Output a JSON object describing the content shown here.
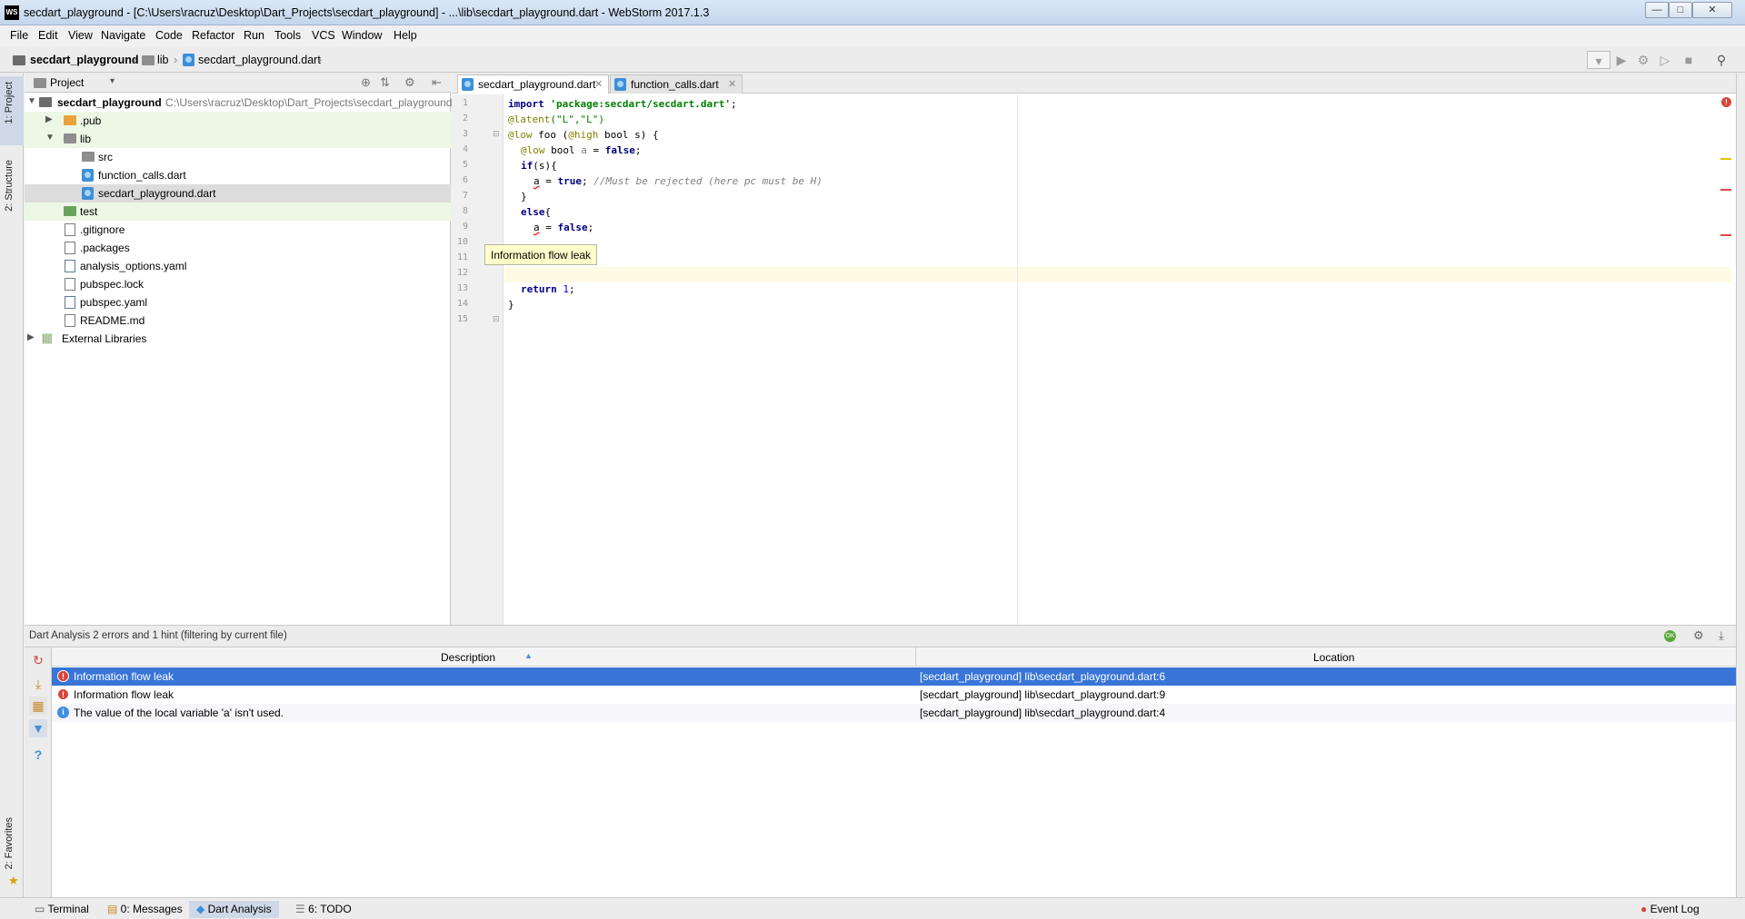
{
  "window": {
    "title": "secdart_playground - [C:\\Users\\racruz\\Desktop\\Dart_Projects\\secdart_playground] - ...\\lib\\secdart_playground.dart - WebStorm 2017.1.3",
    "logo": "WS"
  },
  "menu": [
    "File",
    "Edit",
    "View",
    "Navigate",
    "Code",
    "Refactor",
    "Run",
    "Tools",
    "VCS",
    "Window",
    "Help"
  ],
  "breadcrumb": [
    "secdart_playground",
    "lib",
    "secdart_playground.dart"
  ],
  "left_strip": {
    "project_tab": "1: Project",
    "structure_tab": "2: Structure",
    "favorites_tab": "2: Favorites"
  },
  "project": {
    "header": "Project",
    "root_name": "secdart_playground",
    "root_path": "C:\\Users\\racruz\\Desktop\\Dart_Projects\\secdart_playground",
    "items": [
      ".pub",
      "lib",
      "src",
      "function_calls.dart",
      "secdart_playground.dart",
      "test",
      ".gitignore",
      ".packages",
      "analysis_options.yaml",
      "pubspec.lock",
      "pubspec.yaml",
      "README.md",
      "External Libraries"
    ]
  },
  "editor": {
    "tabs": [
      "secdart_playground.dart",
      "function_calls.dart"
    ],
    "line_numbers": [
      "1",
      "2",
      "3",
      "4",
      "5",
      "6",
      "7",
      "8",
      "9",
      "10",
      "11",
      "12",
      "13",
      "14",
      "15"
    ],
    "code": {
      "l1_kw": "import ",
      "l1_str": "'package:secdart/secdart.dart'",
      "l1_end": ";",
      "l2_ann": "@latent",
      "l2_args": "(\"L\",\"L\")",
      "l3_ann": "@low",
      "l3_a": " foo (",
      "l3_ann2": "@high",
      "l3_b": " bool s) {",
      "l4_ann": "@low",
      "l4_a": " bool ",
      "l4_var": "a",
      "l4_b": " = ",
      "l4_kw": "false",
      "l4_end": ";",
      "l5_kw": "if",
      "l5_rest": "(s){",
      "l6_var": "a",
      "l6_a": " = ",
      "l6_kw": "true",
      "l6_b": "; ",
      "l6_cmt": "//Must be rejected (here pc must be H)",
      "l7": "}",
      "l8_kw": "else",
      "l8_rest": "{",
      "l9_var": "a",
      "l9_a": " = ",
      "l9_kw": "false",
      "l9_end": ";",
      "l13_kw": "return ",
      "l13_num": "1",
      "l13_end": ";",
      "l14": "}"
    },
    "tooltip": "Information flow leak"
  },
  "bottom": {
    "header": "Dart Analysis 2 errors and 1 hint (filtering by current file)",
    "col_description": "Description",
    "col_location": "Location",
    "problems": [
      {
        "description": "Information flow leak",
        "location": "[secdart_playground] lib\\secdart_playground.dart:6",
        "severity": "error"
      },
      {
        "description": "Information flow leak",
        "location": "[secdart_playground] lib\\secdart_playground.dart:9",
        "severity": "error"
      },
      {
        "description": "The value of the local variable 'a' isn't used.",
        "location": "[secdart_playground] lib\\secdart_playground.dart:4",
        "severity": "hint"
      }
    ]
  },
  "statusbar": {
    "terminal": "Terminal",
    "messages": "0: Messages",
    "dart_analysis": "Dart Analysis",
    "todo": "6: TODO",
    "event_log": "Event Log"
  },
  "colors": {
    "selection": "#3875d7",
    "error": "#d8453b",
    "hint": "#3f8fe0",
    "current_line": "#fffae3"
  }
}
